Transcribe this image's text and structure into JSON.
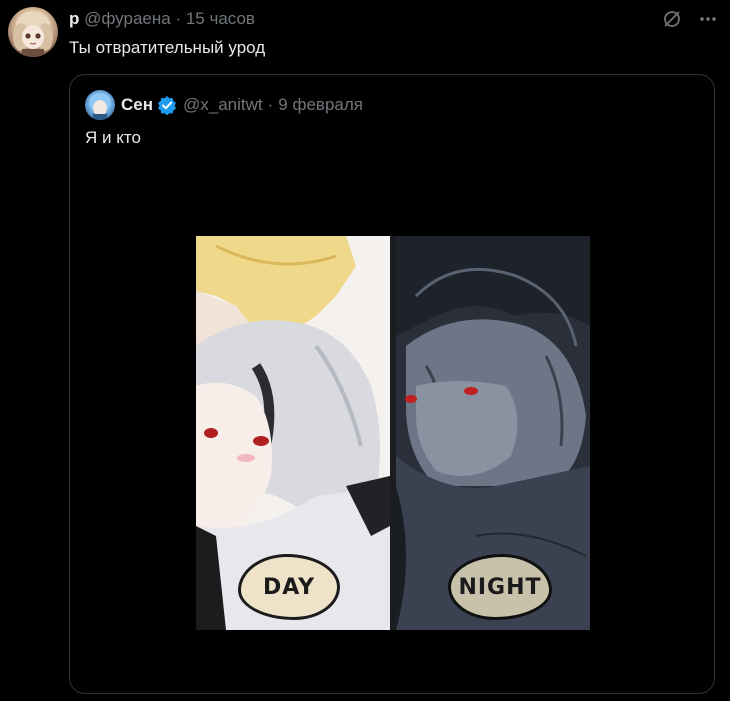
{
  "tweet": {
    "author_name": "р",
    "author_handle": "@фураена",
    "separator": "·",
    "time": "15 часов",
    "text": "Ты отвратительный урод",
    "avatar_icon": "user-avatar",
    "grok_icon": "grok-icon",
    "more_icon": "more-icon"
  },
  "quote": {
    "author_name": "Сен",
    "verified": true,
    "verified_color": "#1d9bf0",
    "author_handle": "@x_anitwt",
    "separator": "·",
    "date": "9 февраля",
    "text": "Я и кто",
    "media": {
      "panels": [
        {
          "label": "DAY"
        },
        {
          "label": "NIGHT"
        }
      ]
    }
  },
  "colors": {
    "background": "#000000",
    "text": "#e7e9ea",
    "muted": "#71767b",
    "border": "#2f3336"
  }
}
